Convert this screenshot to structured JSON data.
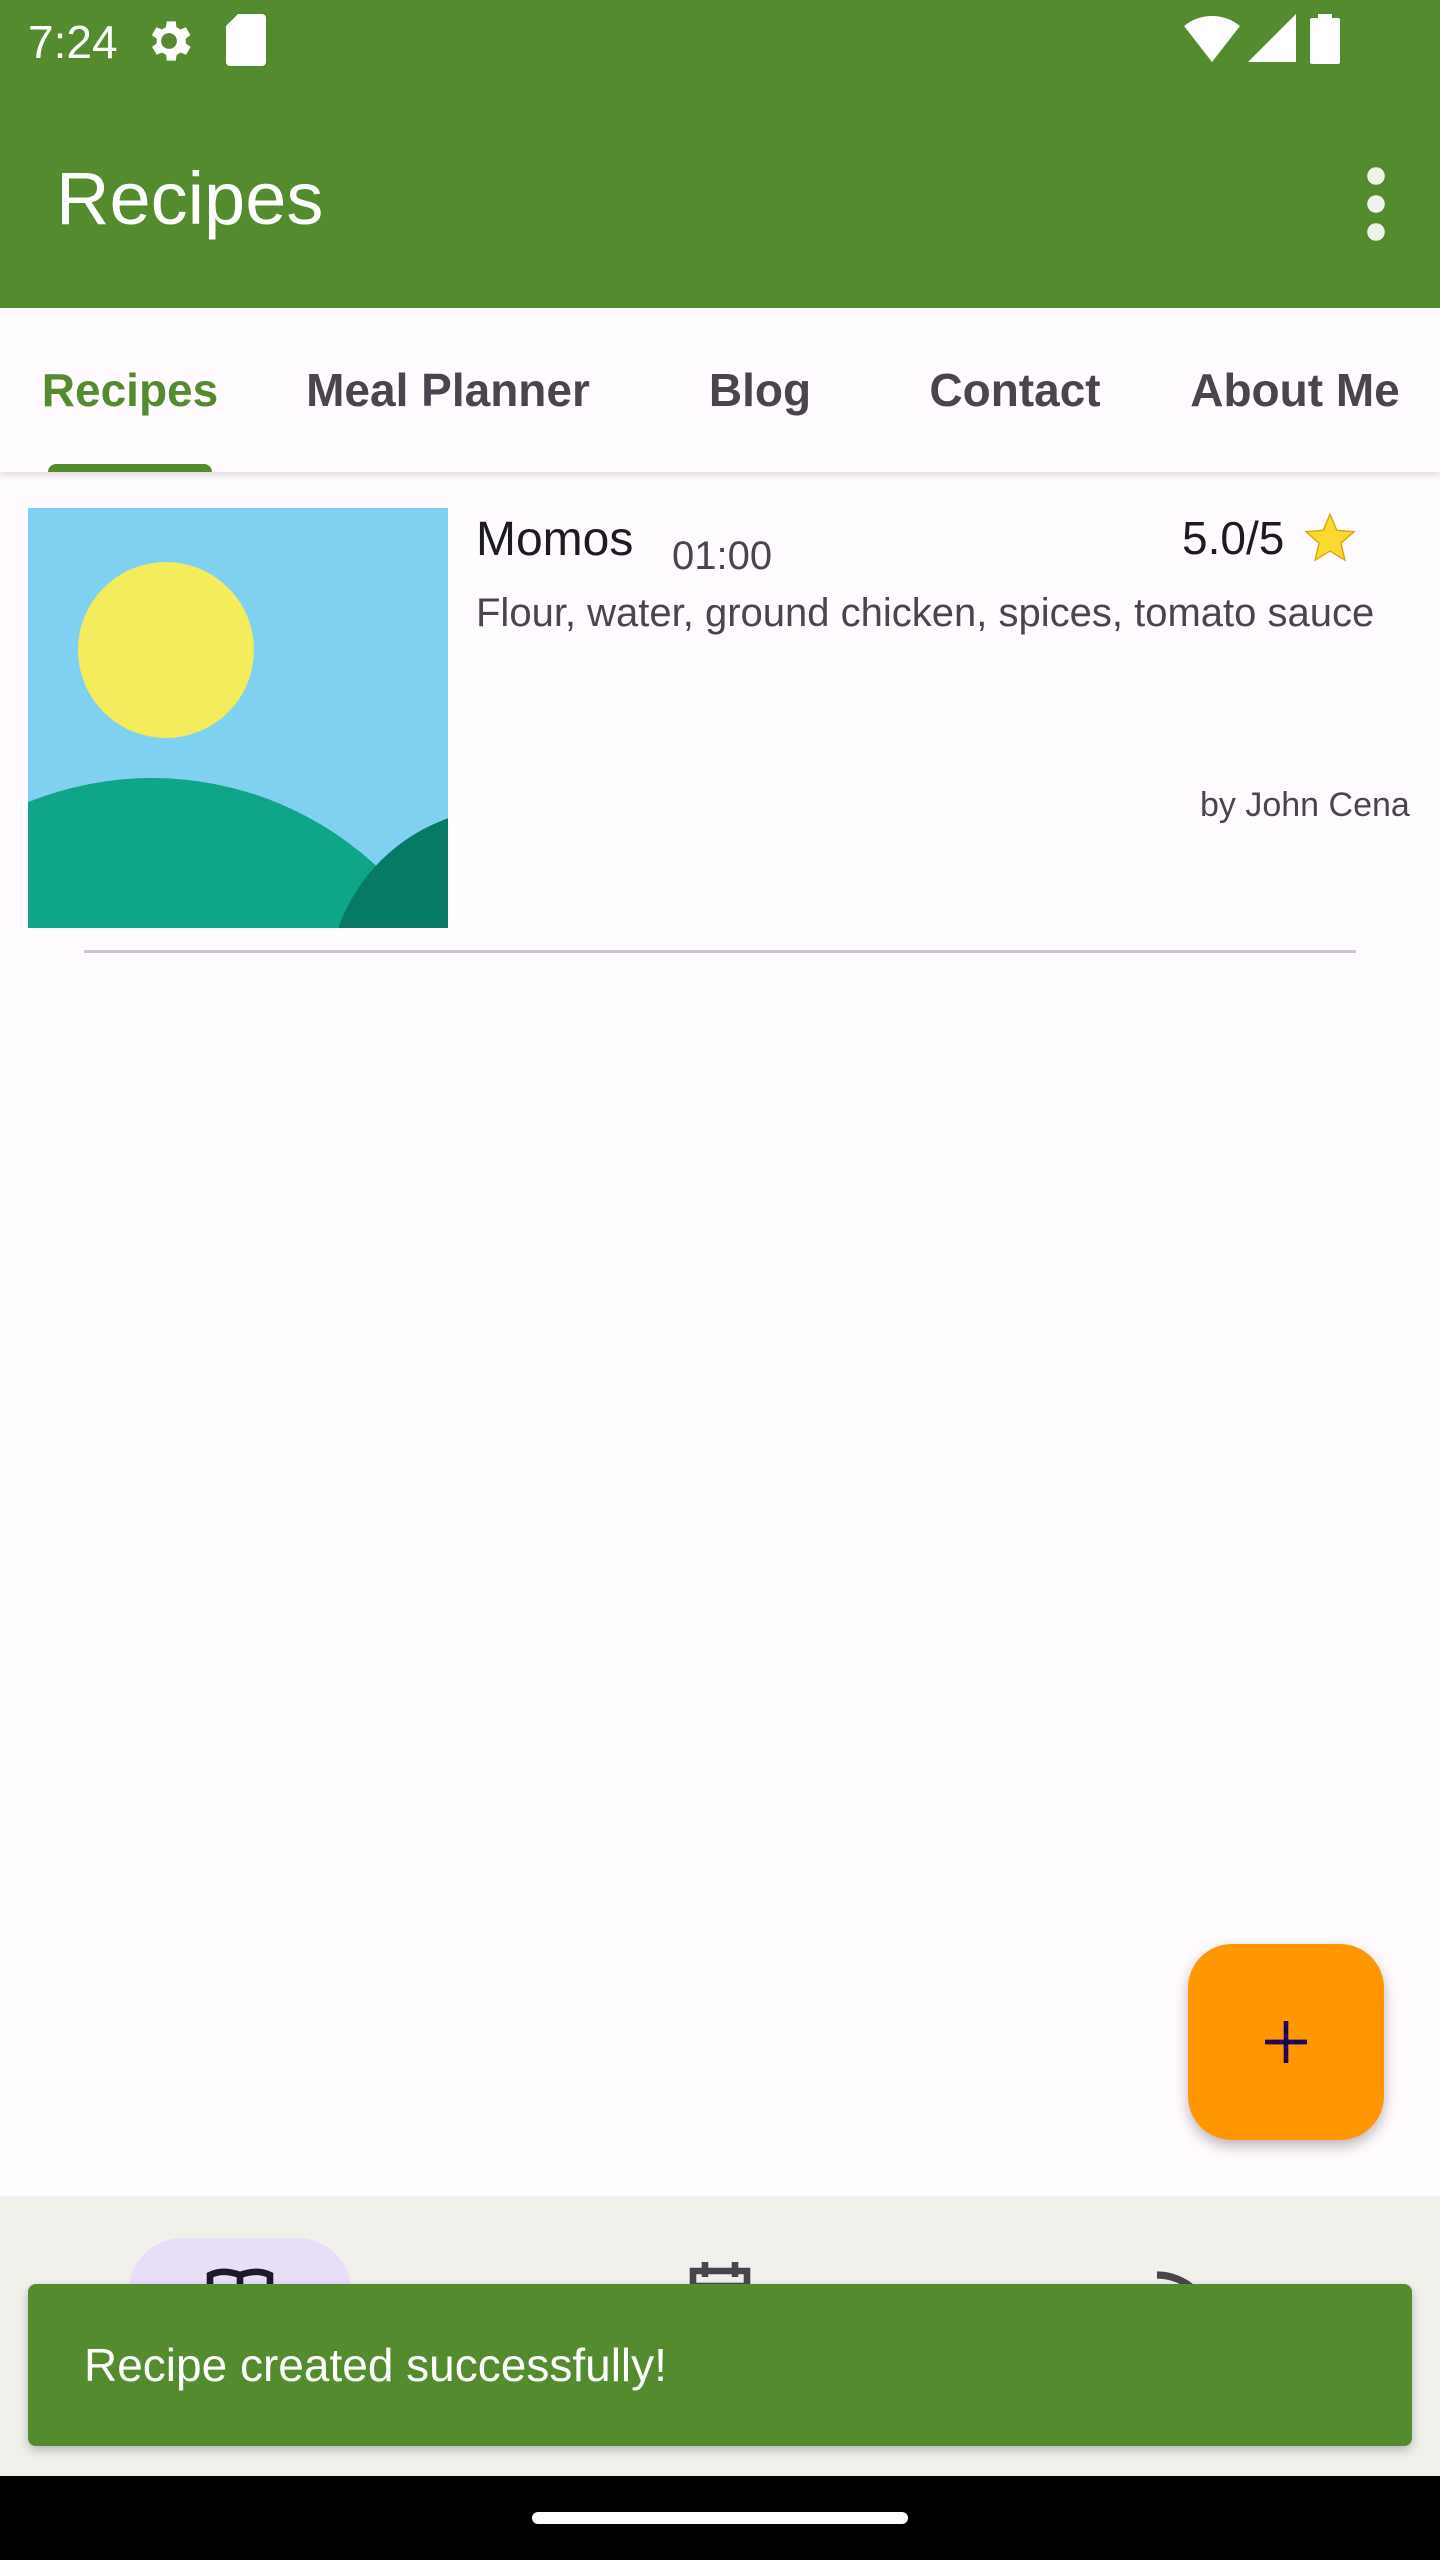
{
  "status_bar": {
    "time": "7:24"
  },
  "app_bar": {
    "title": "Recipes",
    "overflow_icon": "more-vert-icon"
  },
  "tabs": [
    {
      "label": "Recipes",
      "active": true
    },
    {
      "label": "Meal Planner",
      "active": false
    },
    {
      "label": "Blog",
      "active": false
    },
    {
      "label": "Contact",
      "active": false
    },
    {
      "label": "About Me",
      "active": false
    }
  ],
  "recipe": {
    "name": "Momos",
    "time": "01:00",
    "rating": "5.0/5",
    "ingredients": "Flour, water, ground chicken, spices, tomato sauce",
    "author": "by John Cena"
  },
  "fab": {
    "icon": "add-icon"
  },
  "snackbar": {
    "message": "Recipe created successfully!"
  },
  "colors": {
    "primary": "#558b2f",
    "fab": "#ff9800",
    "star": "#fdd835",
    "background": "#fffbfe"
  }
}
